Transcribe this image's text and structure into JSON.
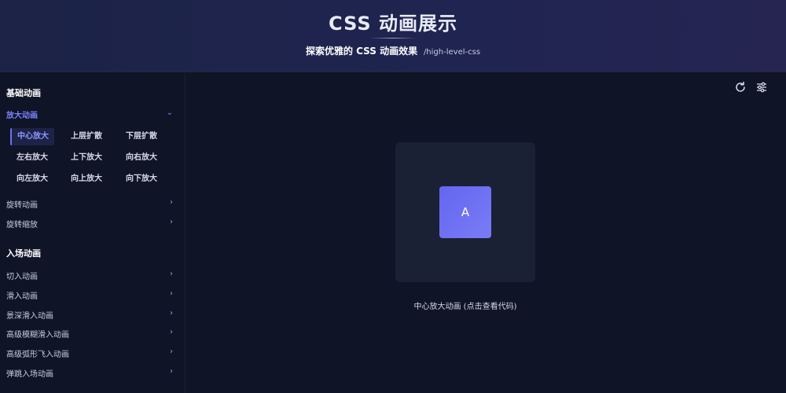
{
  "header": {
    "title": "CSS 动画展示",
    "subtitle_strong": "探索优雅的 CSS 动画效果",
    "subtitle_path": "/high-level-css"
  },
  "sidebar": {
    "groups": [
      {
        "title": "基础动画",
        "items": [
          {
            "label": "放大动画",
            "expanded": true,
            "sub_items": [
              "中心放大",
              "上层扩散",
              "下层扩散",
              "左右放大",
              "上下放大",
              "向右放大",
              "向左放大",
              "向上放大",
              "向下放大"
            ],
            "selected_sub_item": "中心放大"
          },
          {
            "label": "旋转动画"
          },
          {
            "label": "旋转缩放"
          }
        ]
      },
      {
        "title": "入场动画",
        "items": [
          {
            "label": "切入动画"
          },
          {
            "label": "滑入动画"
          },
          {
            "label": "景深滑入动画"
          },
          {
            "label": "高级模糊滑入动画"
          },
          {
            "label": "高级弧形飞入动画"
          },
          {
            "label": "弹跳入场动画"
          }
        ]
      }
    ]
  },
  "toolbar": {
    "icons": [
      "refresh-icon",
      "settings-sliders-icon"
    ]
  },
  "preview": {
    "box_letter": "A",
    "caption": "中心放大动画 (点击查看代码)"
  },
  "colors": {
    "accent": "#6366f1",
    "background": "#0f1426",
    "header_bg": "#1f2450"
  }
}
